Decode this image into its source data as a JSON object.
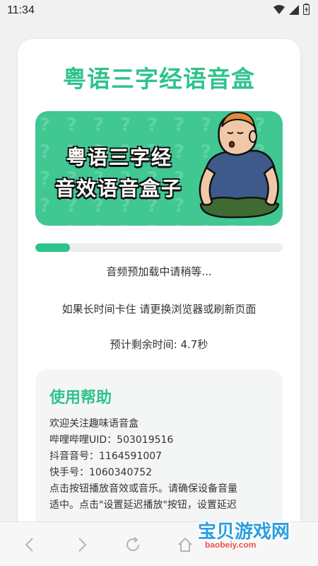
{
  "status_bar": {
    "time": "11:34"
  },
  "app": {
    "title": "粤语三字经语音盒"
  },
  "banner": {
    "line1": "粤语三字经",
    "line2": "音效语音盒子"
  },
  "progress": {
    "fraction": 0.14
  },
  "status": {
    "loading": "音频预加载中请稍等...",
    "hint": "如果长时间卡住 请更换浏览器或刷新页面",
    "remaining": "预计剩余时间: 4.7秒"
  },
  "help": {
    "title": "使用帮助",
    "lines": [
      "欢迎关注趣味语音盒",
      "哔哩哔哩UID：503019516",
      "抖音音号：1164591007",
      "快手号：1060340752",
      "点击按钮播放音效或音乐。请确保设备音量",
      "适中。点击\"设置延迟播放\"按钮，设置延迟"
    ]
  },
  "watermark": {
    "text": "宝贝游戏网",
    "url": "baobeiy.com"
  },
  "colors": {
    "accent": "#2fc38c",
    "banner": "#40c792"
  },
  "icons": [
    "wifi-icon",
    "signal-icon",
    "battery-icon",
    "back-icon",
    "forward-icon",
    "refresh-icon",
    "home-icon"
  ]
}
